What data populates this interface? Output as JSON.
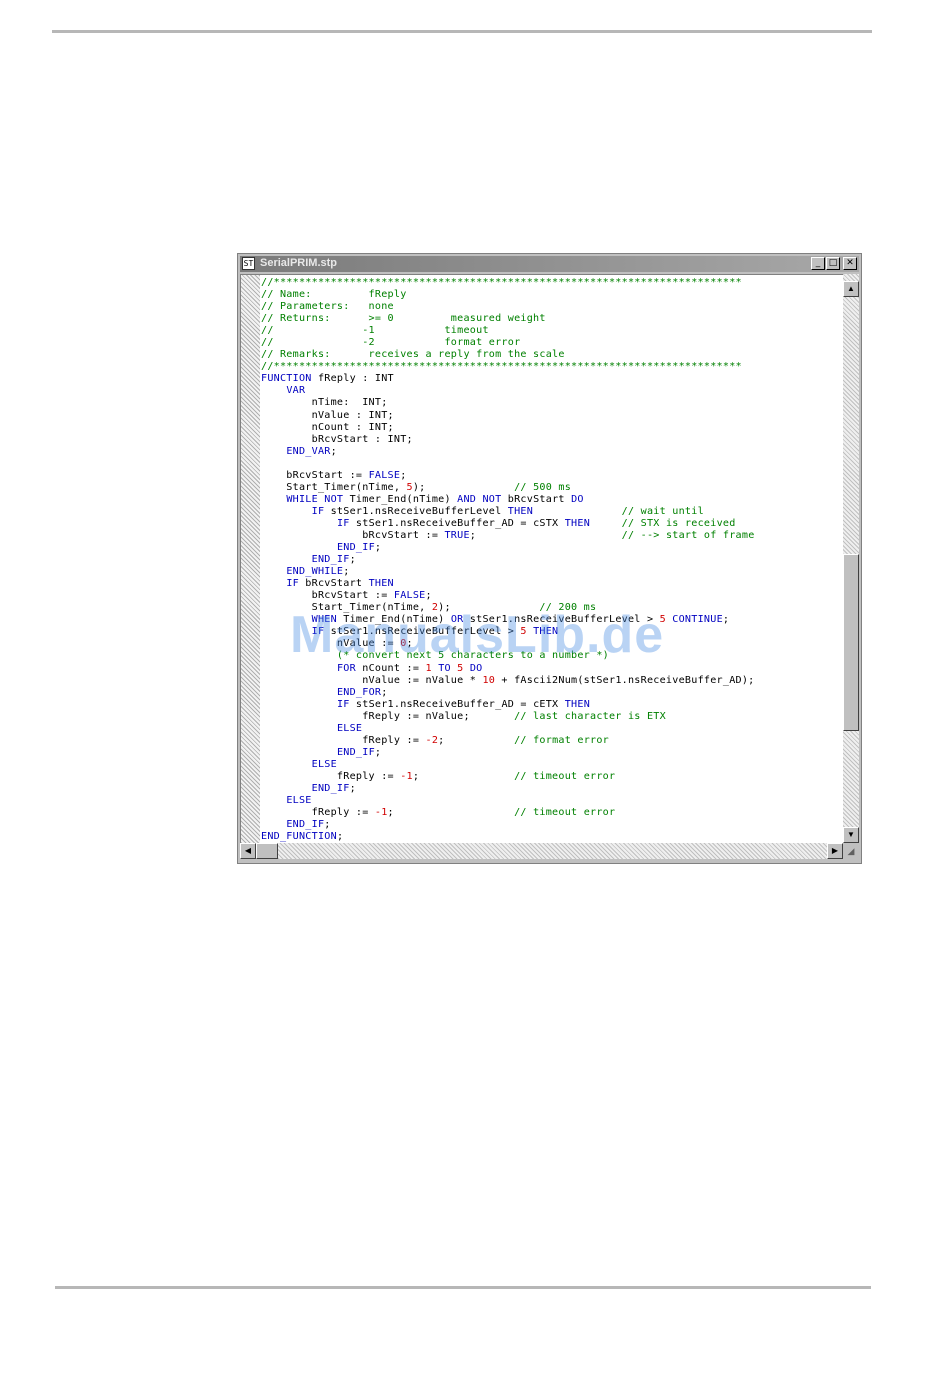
{
  "window": {
    "title": "SerialPRIM.stp",
    "icon_label": "ST",
    "controls": {
      "minimize": "_",
      "maximize": "□",
      "close": "✕"
    }
  },
  "scrollbar_glyphs": {
    "up": "▲",
    "down": "▼",
    "left": "◀",
    "right": "▶",
    "grip": "◢"
  },
  "code_lines": [
    "//**************************************************************************",
    "// Name:         fReply",
    "// Parameters:   none",
    "// Returns:      >= 0         measured weight",
    "//              -1           timeout",
    "//              -2           format error",
    "// Remarks:      receives a reply from the scale",
    "//**************************************************************************",
    "FUNCTION fReply : INT",
    "    VAR",
    "        nTime:  INT;",
    "        nValue : INT;",
    "        nCount : INT;",
    "        bRcvStart : INT;",
    "    END_VAR;",
    "",
    "    bRcvStart := FALSE;",
    "    Start_Timer(nTime, 5);              // 500 ms",
    "    WHILE NOT Timer_End(nTime) AND NOT bRcvStart DO",
    "        IF stSer1.nsReceiveBufferLevel THEN              // wait until",
    "            IF stSer1.nsReceiveBuffer_AD = cSTX THEN     // STX is received",
    "                bRcvStart := TRUE;                       // --> start of frame",
    "            END_IF;",
    "        END_IF;",
    "    END_WHILE;",
    "    IF bRcvStart THEN",
    "        bRcvStart := FALSE;",
    "        Start_Timer(nTime, 2);              // 200 ms",
    "        WHEN Timer_End(nTime) OR stSer1.nsReceiveBufferLevel > 5 CONTINUE;",
    "        IF stSer1.nsReceiveBufferLevel > 5 THEN",
    "            nValue := 0;",
    "            (* convert next 5 characters to a number *)",
    "            FOR nCount := 1 TO 5 DO",
    "                nValue := nValue * 10 + fAscii2Num(stSer1.nsReceiveBuffer_AD);",
    "            END_FOR;",
    "            IF stSer1.nsReceiveBuffer_AD = cETX THEN",
    "                fReply := nValue;       // last character is ETX",
    "            ELSE",
    "                fReply := -2;           // format error",
    "            END_IF;",
    "        ELSE",
    "            fReply := -1;               // timeout error",
    "        END_IF;",
    "    ELSE",
    "        fReply := -1;                   // timeout error",
    "    END_IF;",
    "END_FUNCTION;"
  ],
  "syntax_colors": {
    "comment": "#008000",
    "keyword": "#0000c0",
    "number": "#d00000",
    "text": "#000000"
  },
  "watermark": "ManualsLib.de"
}
